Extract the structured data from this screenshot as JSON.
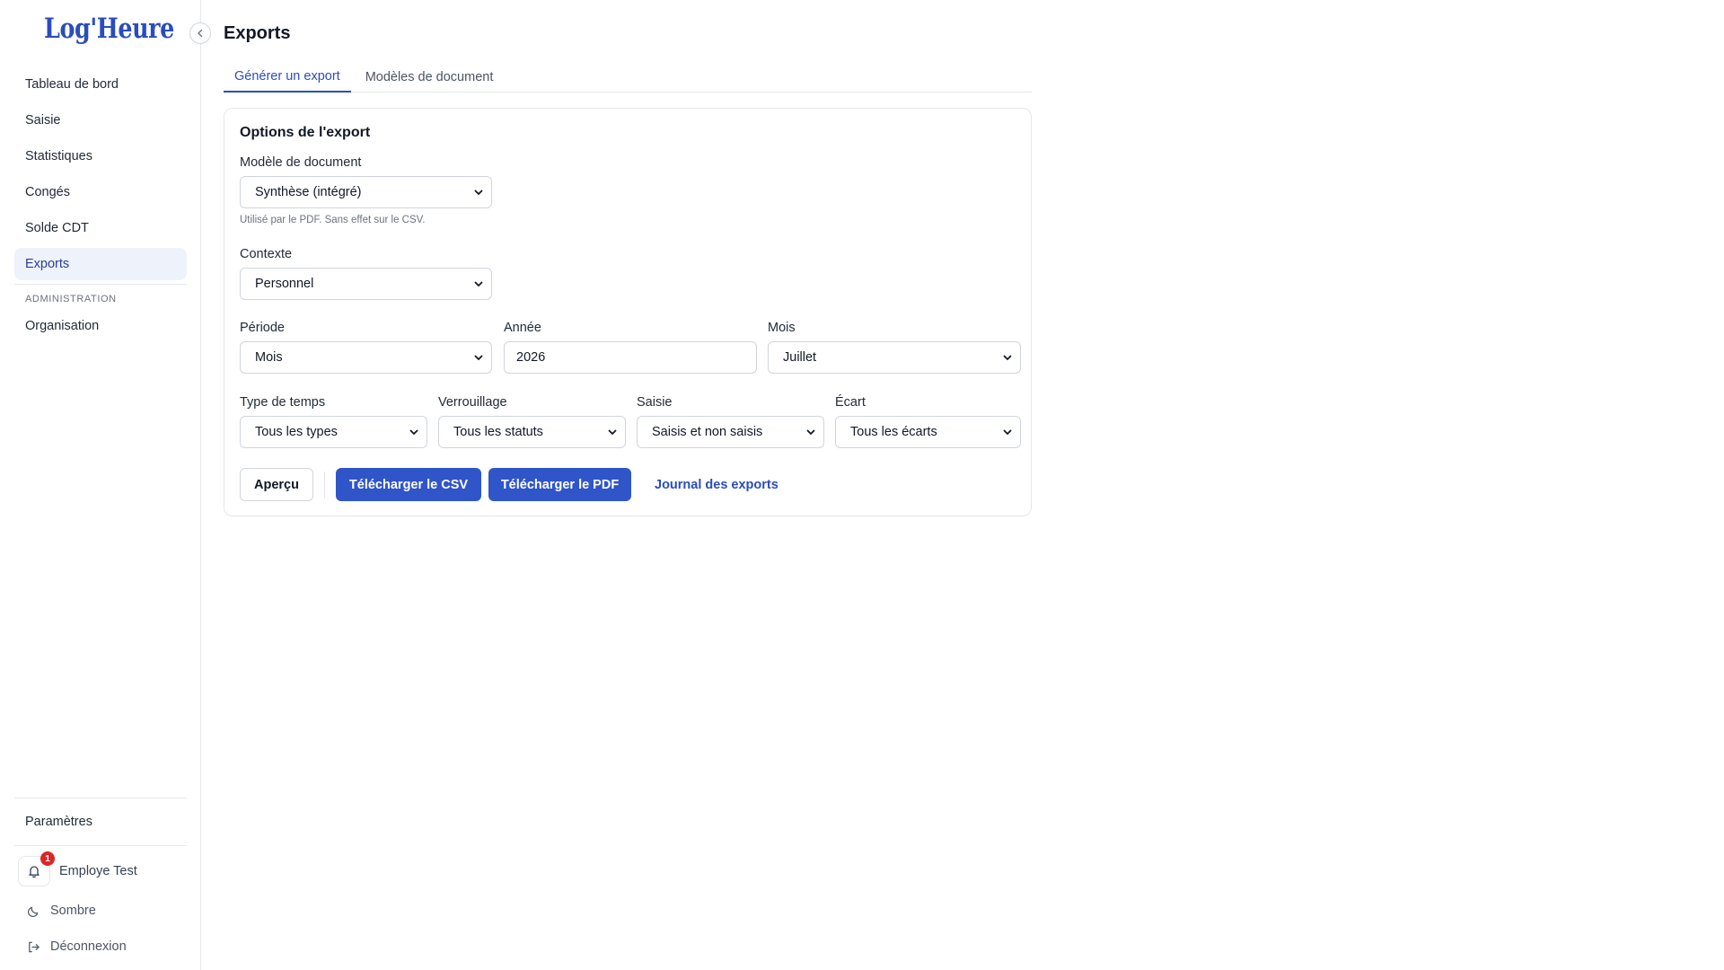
{
  "app": {
    "logo": "Log'Heure"
  },
  "sidebar": {
    "items": [
      {
        "label": "Tableau de bord"
      },
      {
        "label": "Saisie"
      },
      {
        "label": "Statistiques"
      },
      {
        "label": "Congés"
      },
      {
        "label": "Solde CDT"
      },
      {
        "label": "Exports"
      }
    ],
    "admin_section": "ADMINISTRATION",
    "admin_items": [
      {
        "label": "Organisation"
      }
    ],
    "settings": "Paramètres",
    "user": {
      "name": "Employe Test",
      "notifications": "1"
    },
    "theme": "Sombre",
    "logout": "Déconnexion"
  },
  "page": {
    "title": "Exports"
  },
  "tabs": [
    {
      "label": "Générer un export"
    },
    {
      "label": "Modèles de document"
    }
  ],
  "form": {
    "title": "Options de l'export",
    "template": {
      "label": "Modèle de document",
      "value": "Synthèse (intégré)",
      "help": "Utilisé par le PDF. Sans effet sur le CSV."
    },
    "context": {
      "label": "Contexte",
      "value": "Personnel"
    },
    "period": {
      "label": "Période",
      "value": "Mois"
    },
    "year": {
      "label": "Année",
      "value": "2026"
    },
    "month": {
      "label": "Mois",
      "value": "Juillet"
    },
    "time_type": {
      "label": "Type de temps",
      "value": "Tous les types"
    },
    "lock": {
      "label": "Verrouillage",
      "value": "Tous les statuts"
    },
    "entry": {
      "label": "Saisie",
      "value": "Saisis et non saisis"
    },
    "gap": {
      "label": "Écart",
      "value": "Tous les écarts"
    }
  },
  "actions": {
    "preview": "Aperçu",
    "download_csv": "Télécharger le CSV",
    "download_pdf": "Télécharger le PDF",
    "log": "Journal des exports"
  },
  "colors": {
    "accent": "#2f55c9",
    "brand": "#2a4dbd",
    "badge": "#dc2626"
  }
}
